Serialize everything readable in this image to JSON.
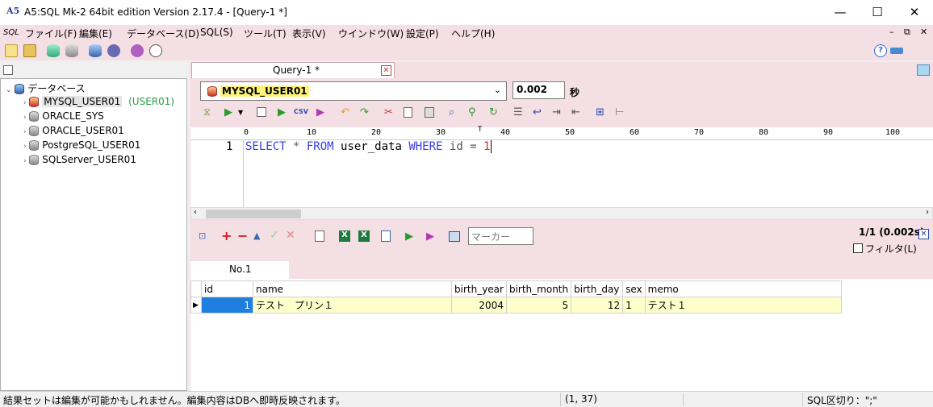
{
  "window": {
    "title": "A5:SQL Mk-2 64bit edition Version 2.17.4 - [Query-1 *]",
    "logo": "A5",
    "minimize": "—",
    "maximize": "☐",
    "close": "✕"
  },
  "menu": {
    "sql_logo": "SQL",
    "items": [
      "ファイル(F)",
      "編集(E)",
      "データベース(D)",
      "SQL(S)",
      "ツール(T)",
      "表示(V)",
      "ウインドウ(W)",
      "設定(P)",
      "ヘルプ(H)"
    ],
    "mdi_min": "–",
    "mdi_restore": "⧉",
    "mdi_close": "✕"
  },
  "tree": {
    "root": "データベース",
    "items": [
      {
        "label": "MYSQL_USER01",
        "extra": "(USER01)"
      },
      {
        "label": "ORACLE_SYS"
      },
      {
        "label": "ORACLE_USER01"
      },
      {
        "label": "PostgreSQL_USER01"
      },
      {
        "label": "SQLServer_USER01"
      }
    ]
  },
  "query_tab": {
    "label": "Query-1 *",
    "close": "✕"
  },
  "connection": {
    "selected": "MYSQL_USER01"
  },
  "exec_time": {
    "value": "0.002",
    "unit": "秒"
  },
  "ruler": {
    "ticks": [
      "0",
      "10",
      "20",
      "30",
      "40",
      "50",
      "60",
      "70",
      "80",
      "90",
      "100"
    ]
  },
  "editor": {
    "line_no": "1",
    "sql_kw1": "SELECT",
    "sql_star": " * ",
    "sql_kw2": "FROM",
    "sql_ident": " user_data ",
    "sql_kw3": "WHERE",
    "sql_cond": " id = ",
    "sql_val": "1"
  },
  "result": {
    "marker_placeholder": "マーカー",
    "count": "1/1 (0.002s)",
    "filter_label": "フィルタ(L)",
    "tab": "No.1",
    "columns": [
      "id",
      "name",
      "birth_year",
      "birth_month",
      "birth_day",
      "sex",
      "memo"
    ],
    "rows": [
      [
        "1",
        "テスト　プリン１",
        "2004",
        "5",
        "12",
        "1",
        "テスト１"
      ]
    ]
  },
  "status": {
    "message": "結果セットは編集が可能かもしれません。編集内容はDBへ即時反映されます。",
    "cursor": "(1, 37)",
    "delimiter": "SQL区切り：\";\""
  },
  "colors": {
    "pane_bg": "#f4dfe4",
    "sql_keyword": "#3a3af0",
    "selected_cell": "#1e7fe0",
    "row_highlight": "#ffffcc"
  }
}
